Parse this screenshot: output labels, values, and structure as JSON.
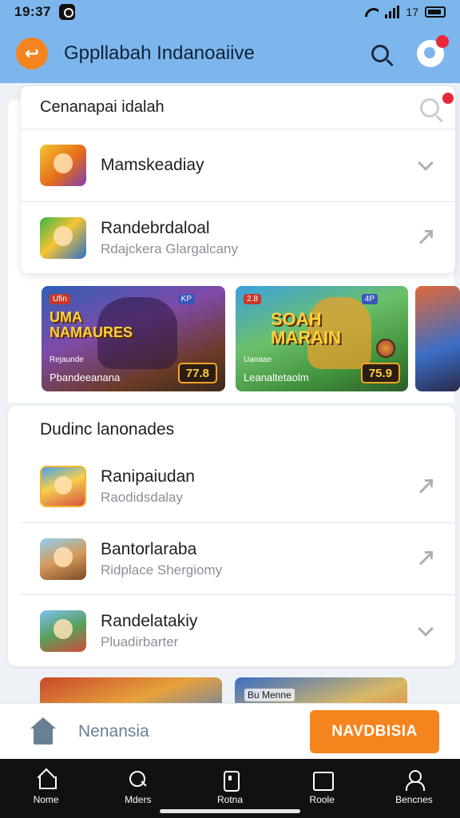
{
  "status_bar": {
    "time": "19:37",
    "right_text": "17"
  },
  "app_bar": {
    "title": "Gppllabah Indanoaiive"
  },
  "top_card": {
    "heading": "Cenanapai idalah",
    "items": [
      {
        "title": "Mamskeadiay",
        "subtitle": "",
        "action": "chevron-down-icon"
      },
      {
        "title": "Randebrdaloal",
        "subtitle": "Rdajckera Glargalcany",
        "action": "arrow-up-right-icon"
      }
    ]
  },
  "carousel": [
    {
      "logo": "UMA NAMAURES",
      "tag": "Ufin",
      "tag_right": "KP",
      "small": "Rejaunde",
      "name": "Pbandeeanana",
      "price": "77.8"
    },
    {
      "logo": "SOAH MARAIN",
      "tag": "2.8",
      "tag_right": "4P",
      "small": "Uanaae",
      "name": "Leanaltetaolm",
      "price": "75.9"
    }
  ],
  "section": {
    "title": "Dudinc lanonades",
    "items": [
      {
        "title": "Ranipaiudan",
        "subtitle": "Raodidsdalay",
        "action": "arrow-up-right-icon"
      },
      {
        "title": "Bantorlaraba",
        "subtitle": "Ridplace Shergiomy",
        "action": "arrow-up-right-icon"
      },
      {
        "title": "Randelatakiy",
        "subtitle": "Pluadirbarter",
        "action": "chevron-down-icon"
      }
    ]
  },
  "bottom_strip": {
    "label_2": "Bu Menne"
  },
  "action_bar": {
    "label": "Nenansia",
    "cta": "NAVDBISIA"
  },
  "tabs": [
    {
      "label": "Nome",
      "icon": "home-icon"
    },
    {
      "label": "Mders",
      "icon": "search-icon"
    },
    {
      "label": "Rotna",
      "icon": "box-icon"
    },
    {
      "label": "Roole",
      "icon": "square-icon"
    },
    {
      "label": "Bencnes",
      "icon": "user-icon"
    }
  ],
  "colors": {
    "app_bar": "#7cb6ec",
    "accent": "#f5841e",
    "badge": "#e8283a",
    "tab_bar": "#111111"
  }
}
